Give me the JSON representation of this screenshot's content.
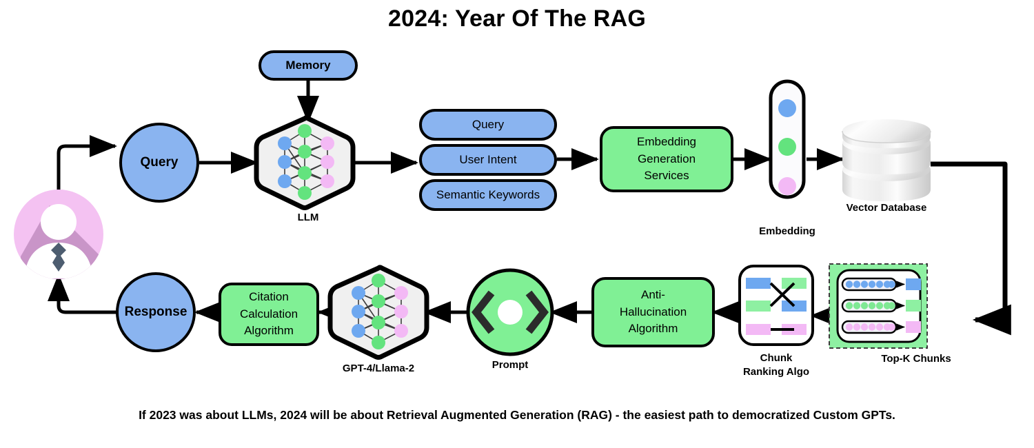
{
  "title": "2024: Year Of The RAG",
  "caption": "If 2023 was about LLMs, 2024 will be about Retrieval Augmented Generation (RAG) - the easiest path to democratized Custom GPTs.",
  "colors": {
    "blue": "#8ab4f0",
    "green": "#80f095",
    "pink": "#f3c0f2",
    "pink_avatar": "#f4c2f2",
    "pink_avatar_shadow": "#c491c4",
    "tie": "#4d5d70",
    "stroke": "#000000",
    "hex_fill": "#f0f0f0",
    "db_light": "#fbfbfb",
    "db_shade": "#d6d6d6",
    "topk_panel": "#8ef0a2",
    "chunk_row_bg": "#f2f2f8"
  },
  "nodes": {
    "user": {
      "label": "",
      "icon": "user-avatar-icon"
    },
    "query_circle": {
      "label": "Query"
    },
    "memory": {
      "label": "Memory"
    },
    "llm": {
      "caption": "LLM",
      "icon": "neural-network-icon"
    },
    "outputs": [
      {
        "label": "Query"
      },
      {
        "label": "User Intent"
      },
      {
        "label": "Semantic Keywords"
      }
    ],
    "embedding_service": {
      "lines": [
        "Embedding",
        "Generation",
        "Services"
      ]
    },
    "embedding": {
      "caption": "Embedding",
      "dots": [
        "blue",
        "green",
        "pink"
      ]
    },
    "vector_db": {
      "caption": "Vector Database",
      "icon": "database-cylinder-icon"
    },
    "topk": {
      "caption": "Top-K Chunks",
      "rows": 3,
      "dots_per_row": 7,
      "row_colors": [
        "blue",
        "green",
        "pink"
      ]
    },
    "chunk_ranking": {
      "caption_lines": [
        "Chunk",
        "Ranking Algo"
      ],
      "left_bars": [
        "blue",
        "green",
        "pink"
      ],
      "right_bars": [
        "green",
        "blue",
        "pink"
      ]
    },
    "anti_hallucination": {
      "lines": [
        "Anti-",
        "Hallucination",
        "Algorithm"
      ]
    },
    "prompt": {
      "caption": "Prompt",
      "icon": "code-brackets-icon"
    },
    "gpt": {
      "caption": "GPT-4/Llama-2",
      "icon": "neural-network-icon"
    },
    "citation": {
      "lines": [
        "Citation",
        "Calculation",
        "Algorithm"
      ]
    },
    "response_circle": {
      "label": "Response"
    }
  }
}
